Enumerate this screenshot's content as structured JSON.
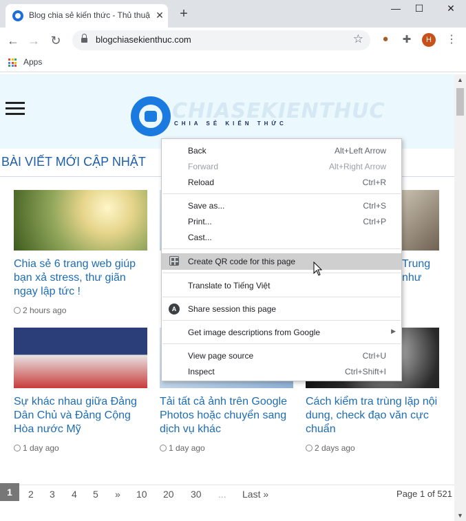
{
  "browser": {
    "tab_title": "Blog chia sẻ kiến thức - Thủ thuật",
    "tab_close": "✕",
    "new_tab": "+",
    "window_controls": {
      "minimize": "—",
      "maximize": "☐",
      "close": "✕"
    },
    "url": "blogchiasekienthuc.com",
    "avatar_initial": "H",
    "bookmarks_apps": "Apps"
  },
  "site": {
    "logo_text": "CHIASEKIENTHUC",
    "logo_sub": "CHIA SẺ KIẾN THỨC",
    "section_title": "BÀI VIẾT MỚI CẬP NHẬT"
  },
  "posts": [
    {
      "title": "Chia sẻ 6 trang web giúp bạn xả stress, thư giãn ngay lập tức !",
      "time": "2 hours ago"
    },
    {
      "title": "Trung như",
      "time": ""
    },
    {
      "title": "Sự khác nhau giữa Đảng Dân Chủ và Đảng Cộng Hòa nước Mỹ",
      "time": "1 day ago"
    },
    {
      "title": "Tải tất cả ảnh trên Google Photos hoặc chuyển sang dịch vụ khác",
      "time": "1 day ago"
    },
    {
      "title": "Cách kiểm tra trùng lặp nội dung, check đạo văn cực chuẩn",
      "time": "2 days ago"
    }
  ],
  "pagination": {
    "pages": [
      "1",
      "2",
      "3",
      "4",
      "5",
      "»",
      "10",
      "20",
      "30",
      "...",
      "Last »"
    ],
    "info": "Page 1 of 521"
  },
  "context_menu": {
    "back": {
      "label": "Back",
      "shortcut": "Alt+Left Arrow"
    },
    "forward": {
      "label": "Forward",
      "shortcut": "Alt+Right Arrow"
    },
    "reload": {
      "label": "Reload",
      "shortcut": "Ctrl+R"
    },
    "save_as": {
      "label": "Save as...",
      "shortcut": "Ctrl+S"
    },
    "print": {
      "label": "Print...",
      "shortcut": "Ctrl+P"
    },
    "cast": {
      "label": "Cast..."
    },
    "qr": {
      "label": "Create QR code for this page"
    },
    "translate": {
      "label": "Translate to Tiếng Việt"
    },
    "share": {
      "label": "Share session this page"
    },
    "image_desc": {
      "label": "Get image descriptions from Google"
    },
    "view_source": {
      "label": "View page source",
      "shortcut": "Ctrl+U"
    },
    "inspect": {
      "label": "Inspect",
      "shortcut": "Ctrl+Shift+I"
    }
  },
  "colors": {
    "header_bg": "#ebf8fd",
    "link_blue": "#1d6cb4",
    "logo_blue": "#1b7ae0",
    "menu_highlight": "#cfcfcf"
  }
}
